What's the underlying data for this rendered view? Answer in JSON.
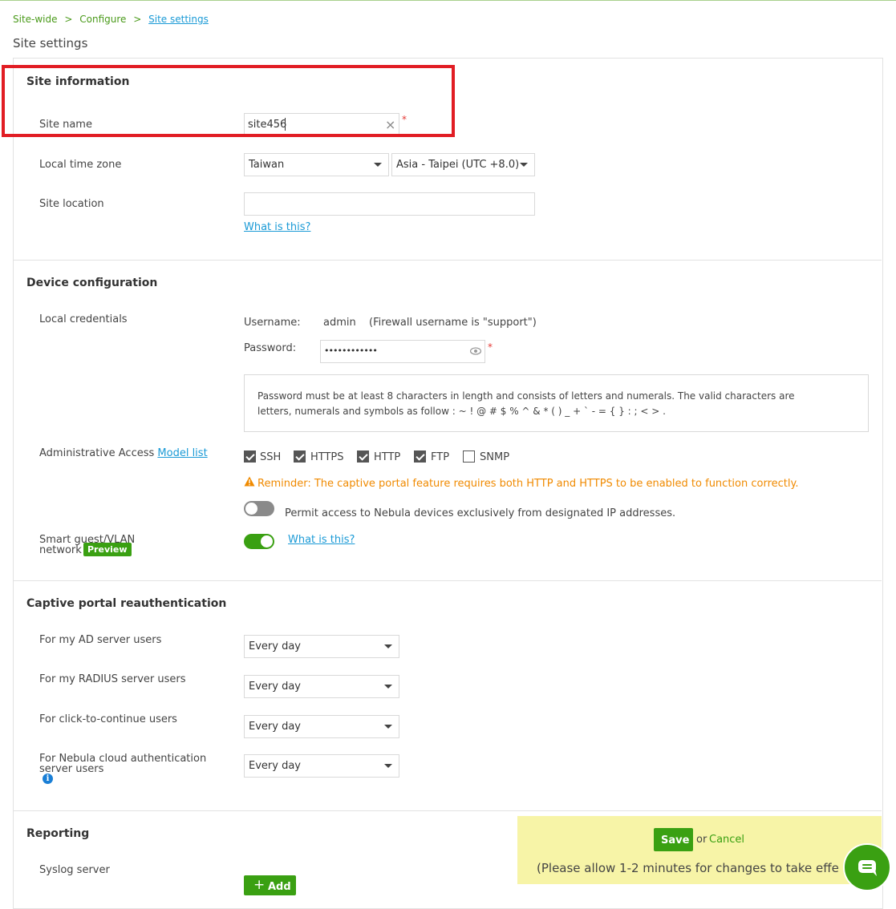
{
  "breadcrumb": {
    "item1": "Site-wide",
    "sep": ">",
    "item2": "Configure",
    "item3": "Site settings"
  },
  "page_title": "Site settings",
  "site_information": {
    "heading": "Site information",
    "site_name_label": "Site name",
    "site_name_value": "site456",
    "required_mark": "*",
    "local_time_zone_label": "Local time zone",
    "country_value": "Taiwan",
    "timezone_value": "Asia - Taipei (UTC +8.0)",
    "site_location_label": "Site location",
    "site_location_value": "",
    "what_is_this": "What is this?"
  },
  "device_configuration": {
    "heading": "Device configuration",
    "local_credentials_label": "Local credentials",
    "username_label": "Username:",
    "username_value": "admin",
    "firewall_note": "(Firewall username is \"support\")",
    "password_label": "Password:",
    "password_value": "••••••••••••",
    "password_hint_line1": "Password must be at least 8 characters in length and consists of letters and numerals. The valid characters are",
    "password_hint_line2": "letters, numerals and symbols as follow : ~ ! @ # $ % ^ & * ( ) _ + ` - = { } : ; < > .",
    "admin_access_label": "Administrative Access",
    "model_list_link": "Model list",
    "protocols": [
      {
        "label": "SSH",
        "checked": true
      },
      {
        "label": "HTTPS",
        "checked": true
      },
      {
        "label": "HTTP",
        "checked": true
      },
      {
        "label": "FTP",
        "checked": true
      },
      {
        "label": "SNMP",
        "checked": false
      }
    ],
    "reminder": "Reminder: The captive portal feature requires both HTTP and HTTPS to be enabled to function correctly.",
    "permit_access_text": "Permit access to Nebula devices exclusively from designated IP addresses.",
    "permit_access_on": false,
    "smart_guest_label_line1": "Smart guest/VLAN",
    "smart_guest_label_line2": "network",
    "preview_badge": "Preview",
    "smart_guest_on": true,
    "what_is_this": "What is this?"
  },
  "captive_portal": {
    "heading": "Captive portal reauthentication",
    "rows": [
      {
        "label": "For my AD server users",
        "value": "Every day"
      },
      {
        "label": "For my RADIUS server users",
        "value": "Every day"
      },
      {
        "label": "For click-to-continue users",
        "value": "Every day"
      },
      {
        "label": "For Nebula cloud authentication",
        "label2": "server users",
        "value": "Every day"
      }
    ]
  },
  "reporting": {
    "heading": "Reporting",
    "syslog_label": "Syslog server",
    "add_button": "Add"
  },
  "save_bar": {
    "save_button": "Save",
    "or_text": "or",
    "cancel_link": "Cancel",
    "note": "(Please allow 1-2 minutes for changes to take effe"
  },
  "colors": {
    "accent_green": "#3aa012",
    "link_blue": "#1a9ad6",
    "warning_orange": "#f08a00",
    "highlight_red": "#e11d24",
    "save_bar_bg": "#f7f4a7"
  }
}
